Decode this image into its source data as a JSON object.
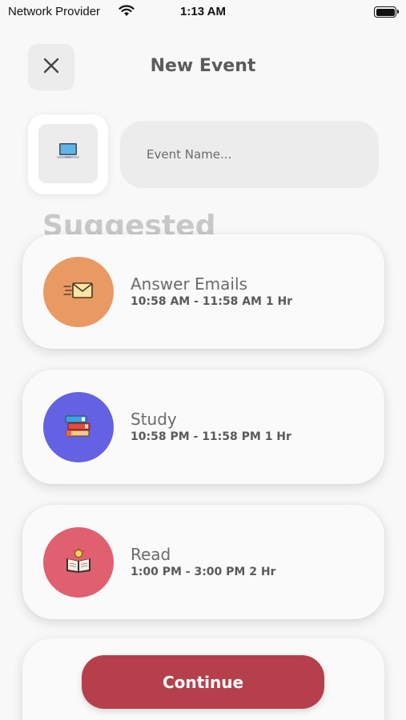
{
  "status_bar": {
    "carrier": "Network Provider",
    "time": "1:13 AM"
  },
  "header": {
    "title": "New Event",
    "close_icon": "close-icon"
  },
  "event_form": {
    "icon": "laptop-icon",
    "name_placeholder": "Event Name...",
    "name_value": ""
  },
  "suggested": {
    "heading": "Suggested",
    "items": [
      {
        "title": "Answer Emails",
        "time": "10:58 AM - 11:58 AM 1 Hr",
        "icon": "email-icon",
        "color": "#e89a62"
      },
      {
        "title": "Study",
        "time": "10:58 PM - 11:58 PM 1 Hr",
        "icon": "books-icon",
        "color": "#6462e2"
      },
      {
        "title": "Read",
        "time": "1:00 PM - 3:00 PM 2 Hr",
        "icon": "open-book-icon",
        "color": "#e0606f"
      }
    ]
  },
  "footer": {
    "continue_label": "Continue",
    "accent_color": "#b5404b"
  }
}
